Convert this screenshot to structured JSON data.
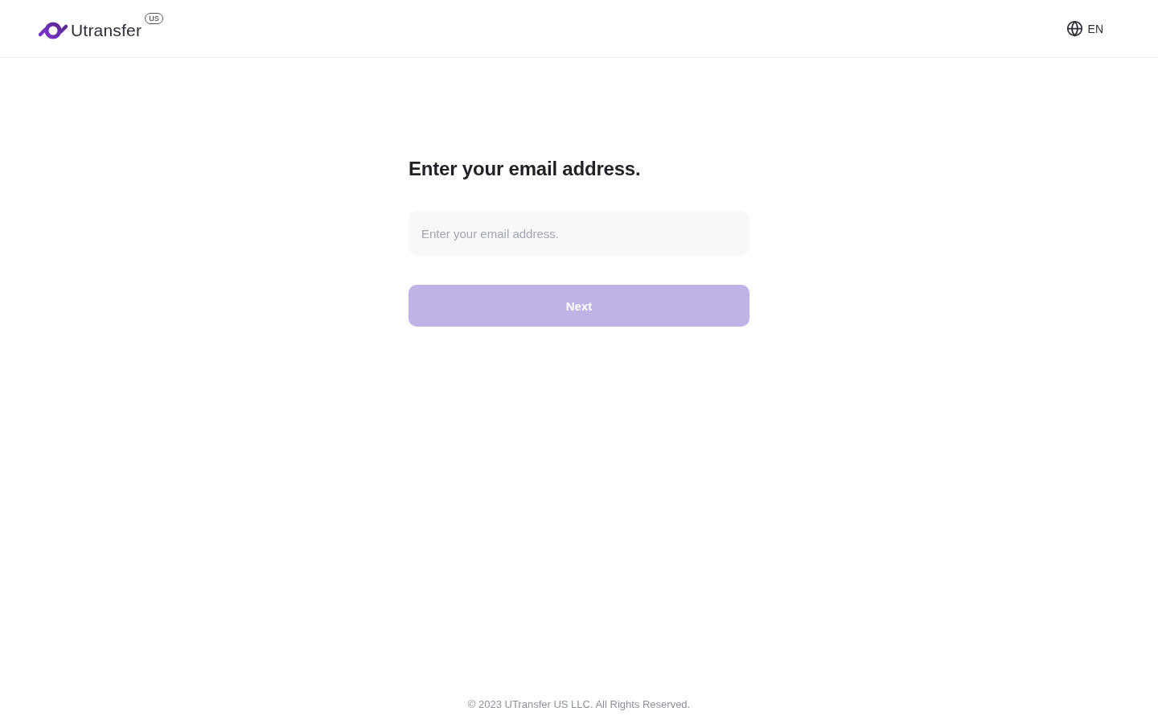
{
  "header": {
    "logo": {
      "name": "Utransfer",
      "region_badge": "US"
    },
    "language": {
      "label": "EN"
    }
  },
  "form": {
    "title": "Enter your email address.",
    "email_field": {
      "placeholder": "Enter your email address."
    },
    "next_button": {
      "label": "Next",
      "disabled": true
    }
  },
  "footer": {
    "copyright": "© 2023 UTransfer US LLC. All Rights Reserved."
  }
}
